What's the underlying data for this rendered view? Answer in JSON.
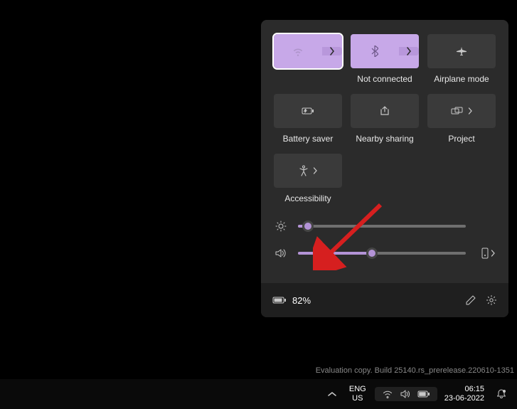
{
  "panel": {
    "tiles": [
      {
        "id": "wifi",
        "label": "",
        "active": true,
        "split": true,
        "focused": true
      },
      {
        "id": "bluetooth",
        "label": "Not connected",
        "active": true,
        "split": true
      },
      {
        "id": "airplane",
        "label": "Airplane mode",
        "active": false,
        "split": false
      },
      {
        "id": "battery-saver",
        "label": "Battery saver",
        "active": false,
        "split": false
      },
      {
        "id": "nearby-sharing",
        "label": "Nearby sharing",
        "active": false,
        "split": false
      },
      {
        "id": "project",
        "label": "Project",
        "active": false,
        "split": true,
        "chev_only": true
      },
      {
        "id": "accessibility",
        "label": "Accessibility",
        "active": false,
        "split": true,
        "chev_only": true
      }
    ],
    "brightness_percent": 6,
    "volume_percent": 44,
    "battery_text": "82%"
  },
  "watermark": {
    "eval_line": "Evaluation copy. Build 25140.rs_prerelease.220610-1351"
  },
  "taskbar": {
    "lang_top": "ENG",
    "lang_bottom": "US",
    "time": "06:15",
    "date": "23-06-2022"
  },
  "colors": {
    "accent": "#c7a8e8",
    "panel_bg": "#2b2b2b"
  }
}
